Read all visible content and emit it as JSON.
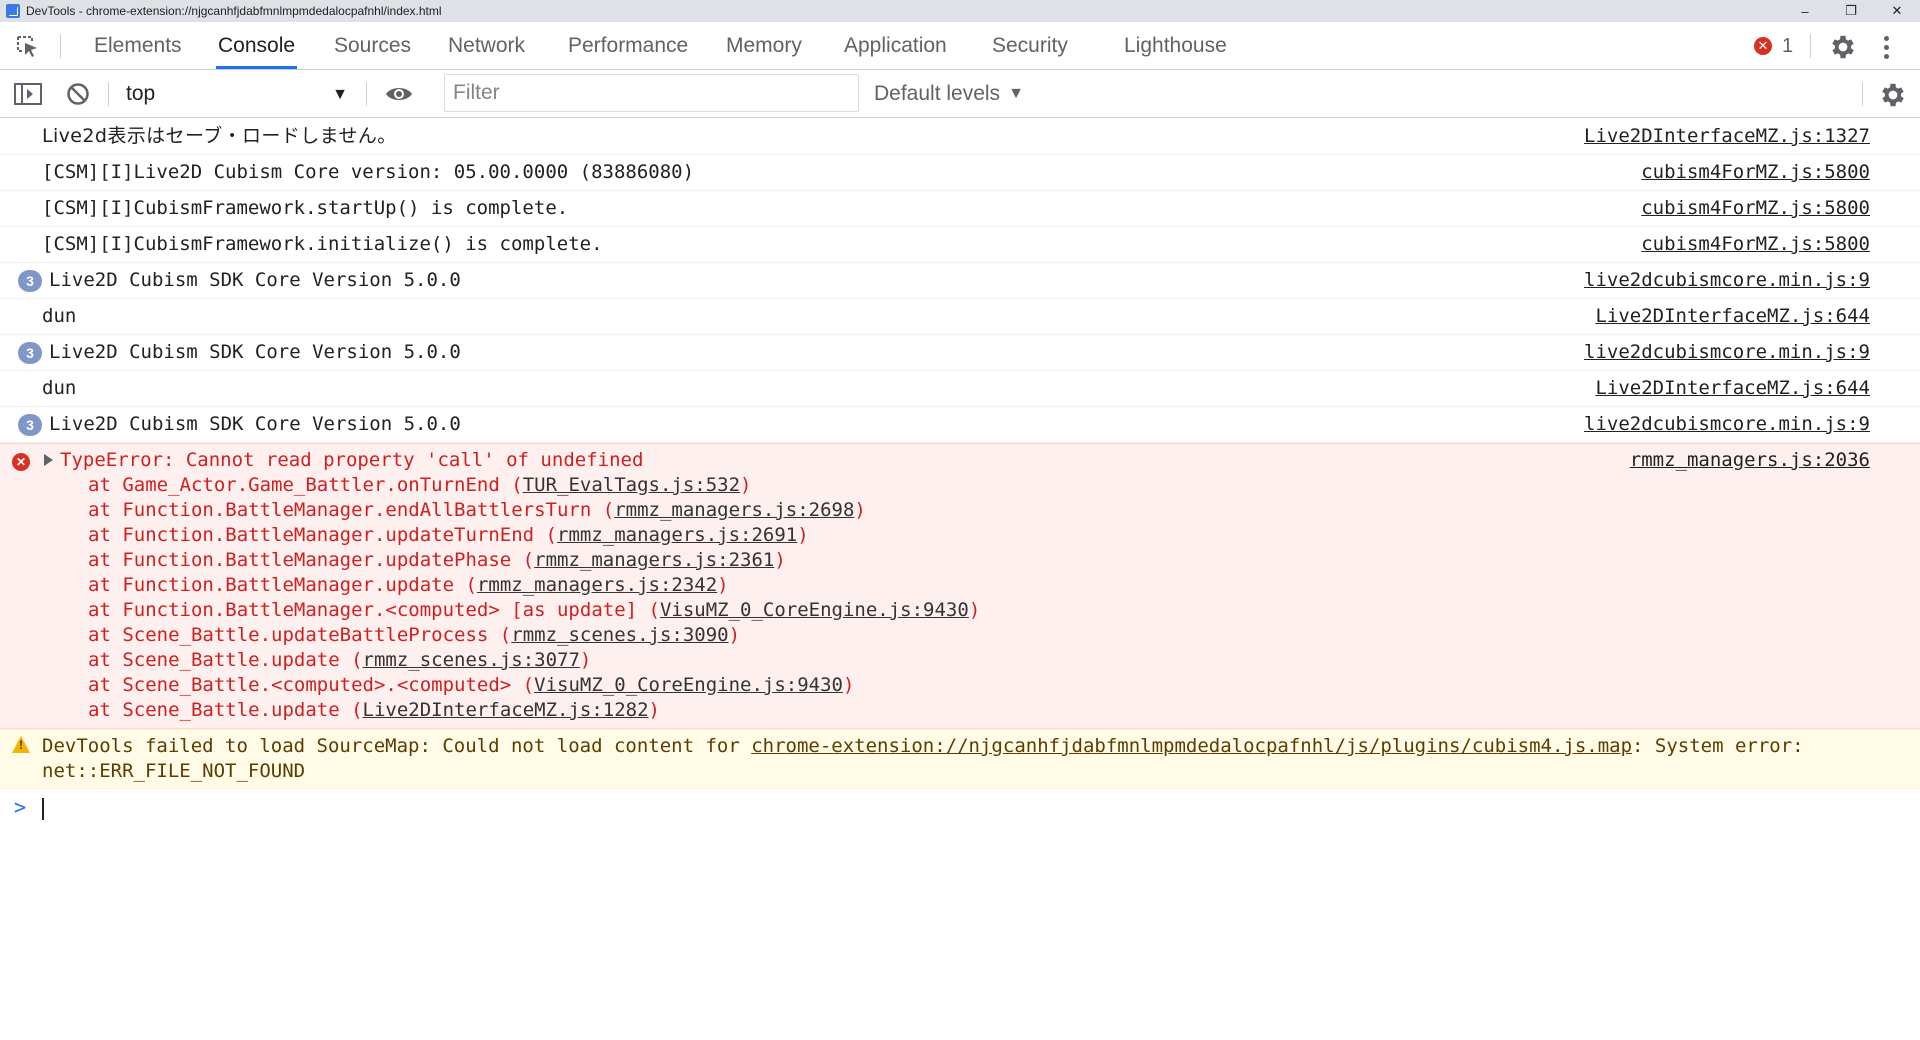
{
  "window": {
    "title": "DevTools - chrome-extension://njgcanhfjdabfmnlmpmdedalocpafnhl/index.html",
    "controls": [
      "‒",
      "❐",
      "✕"
    ]
  },
  "tabs": [
    {
      "label": "Elements",
      "active": false
    },
    {
      "label": "Console",
      "active": true
    },
    {
      "label": "Sources",
      "active": false
    },
    {
      "label": "Network",
      "active": false
    },
    {
      "label": "Performance",
      "active": false
    },
    {
      "label": "Memory",
      "active": false
    },
    {
      "label": "Application",
      "active": false
    },
    {
      "label": "Security",
      "active": false
    },
    {
      "label": "Lighthouse",
      "active": false
    }
  ],
  "error_count": "1",
  "toolbar": {
    "context": "top",
    "filter_placeholder": "Filter",
    "levels": "Default levels"
  },
  "messages": [
    {
      "text": "Live2d表示はセーブ・ロードしません。",
      "source": "Live2DInterfaceMZ.js:1327",
      "count": ""
    },
    {
      "text": "[CSM][I]Live2D Cubism Core version: 05.00.0000 (83886080)",
      "source": "cubism4ForMZ.js:5800",
      "count": ""
    },
    {
      "text": "[CSM][I]CubismFramework.startUp() is complete.",
      "source": "cubism4ForMZ.js:5800",
      "count": ""
    },
    {
      "text": "[CSM][I]CubismFramework.initialize() is complete.",
      "source": "cubism4ForMZ.js:5800",
      "count": ""
    },
    {
      "text": "Live2D Cubism SDK Core Version 5.0.0",
      "source": "live2dcubismcore.min.js:9",
      "count": "3"
    },
    {
      "text": "dun",
      "source": "Live2DInterfaceMZ.js:644",
      "count": ""
    },
    {
      "text": "Live2D Cubism SDK Core Version 5.0.0",
      "source": "live2dcubismcore.min.js:9",
      "count": "3"
    },
    {
      "text": "dun",
      "source": "Live2DInterfaceMZ.js:644",
      "count": ""
    },
    {
      "text": "Live2D Cubism SDK Core Version 5.0.0",
      "source": "live2dcubismcore.min.js:9",
      "count": "3"
    }
  ],
  "error": {
    "head": "TypeError: Cannot read property 'call' of undefined",
    "source": "rmmz_managers.js:2036",
    "stack": [
      {
        "pre": "at Game_Actor.Game_Battler.onTurnEnd (",
        "loc": "TUR_EvalTags.js:532",
        "post": ")"
      },
      {
        "pre": "at Function.BattleManager.endAllBattlersTurn (",
        "loc": "rmmz_managers.js:2698",
        "post": ")"
      },
      {
        "pre": "at Function.BattleManager.updateTurnEnd (",
        "loc": "rmmz_managers.js:2691",
        "post": ")"
      },
      {
        "pre": "at Function.BattleManager.updatePhase (",
        "loc": "rmmz_managers.js:2361",
        "post": ")"
      },
      {
        "pre": "at Function.BattleManager.update (",
        "loc": "rmmz_managers.js:2342",
        "post": ")"
      },
      {
        "pre": "at Function.BattleManager.<computed> [as update] (",
        "loc": "VisuMZ_0_CoreEngine.js:9430",
        "post": ")"
      },
      {
        "pre": "at Scene_Battle.updateBattleProcess (",
        "loc": "rmmz_scenes.js:3090",
        "post": ")"
      },
      {
        "pre": "at Scene_Battle.update (",
        "loc": "rmmz_scenes.js:3077",
        "post": ")"
      },
      {
        "pre": "at Scene_Battle.<computed>.<computed> (",
        "loc": "VisuMZ_0_CoreEngine.js:9430",
        "post": ")"
      },
      {
        "pre": "at Scene_Battle.update (",
        "loc": "Live2DInterfaceMZ.js:1282",
        "post": ")"
      }
    ]
  },
  "warning": {
    "pre": "DevTools failed to load SourceMap: Could not load content for ",
    "link": "chrome-extension://njgcanhfjdabfmnlmpmdedalocpafnhl/js/plugins/cubism4.js.map",
    "post": ": System error: net::ERR_FILE_NOT_FOUND"
  },
  "prompt": ">"
}
